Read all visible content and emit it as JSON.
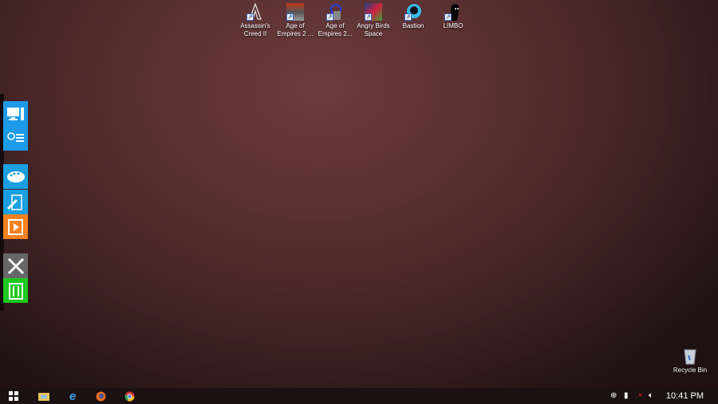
{
  "desktop_icons": [
    {
      "label": "Assassin's Creed II",
      "icon": "assassins-creed-icon"
    },
    {
      "label": "Age of Empires 2 ...",
      "icon": "age-of-empires-icon"
    },
    {
      "label": "Age of Empires 2...",
      "icon": "age-of-empires-icon"
    },
    {
      "label": "Angry Birds Space",
      "icon": "angry-birds-icon"
    },
    {
      "label": "Bastion",
      "icon": "bastion-icon"
    },
    {
      "label": "LIMBO",
      "icon": "limbo-icon"
    }
  ],
  "recycle_bin": {
    "label": "Recycle Bin"
  },
  "dock": {
    "colors": {
      "blue": "#1e9be8",
      "orange": "#f7821e",
      "gray": "#676767",
      "green": "#1fc81f"
    }
  },
  "taskbar": {
    "clock": "10:41 PM"
  }
}
